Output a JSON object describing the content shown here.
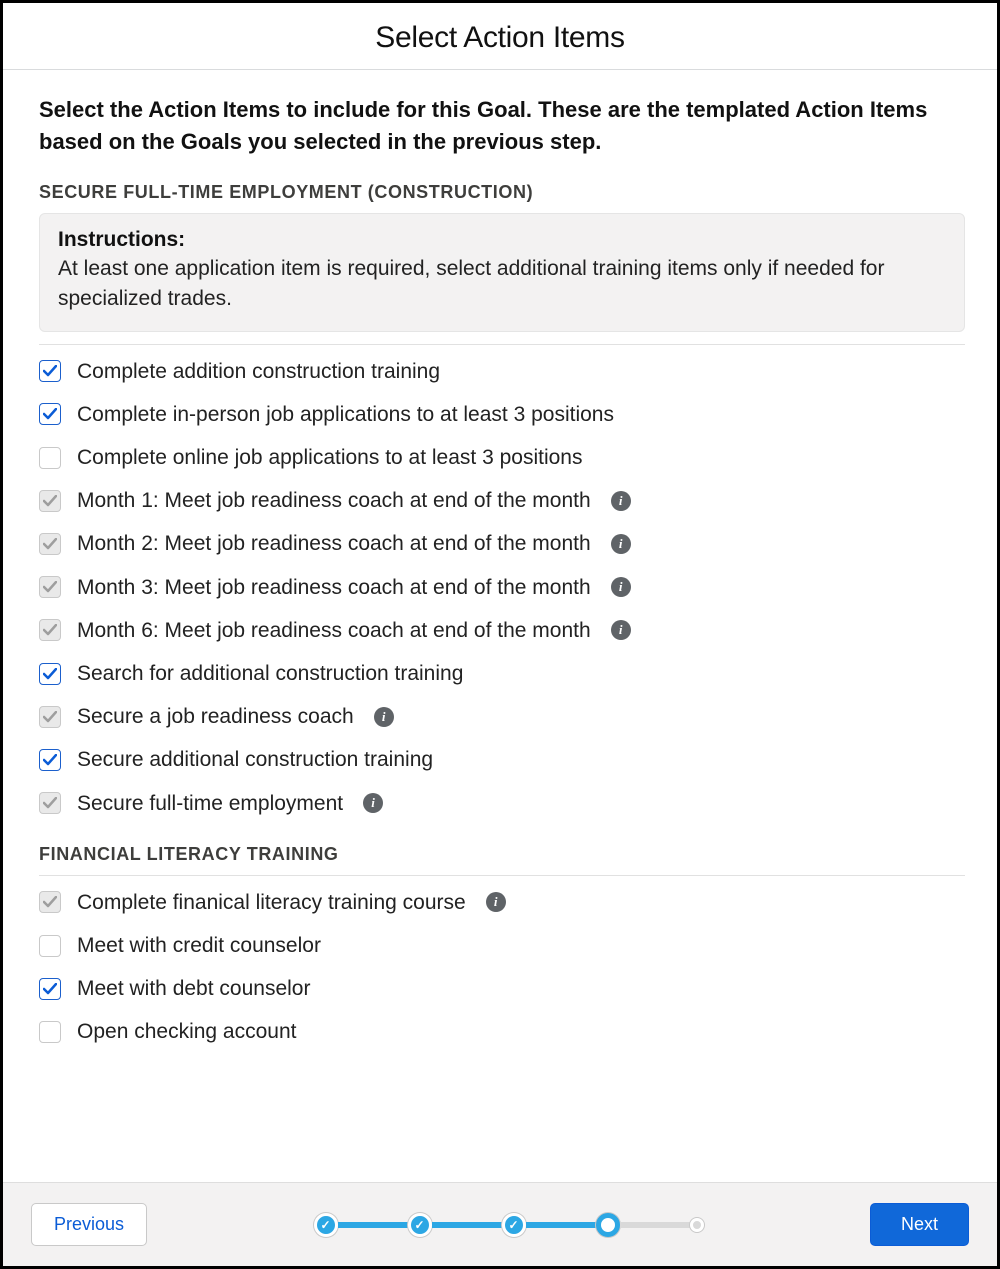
{
  "header": {
    "title": "Select Action Items"
  },
  "intro": "Select the Action Items to include for this Goal. These are the templated Action Items based on the Goals you selected in the previous step.",
  "sections": [
    {
      "title": "SECURE FULL-TIME EMPLOYMENT (CONSTRUCTION)",
      "instructions": {
        "label": "Instructions:",
        "text": "At least one application item is required, select additional training items only if needed for specialized trades."
      },
      "items": [
        {
          "label": "Complete addition construction training",
          "state": "checked",
          "info": false
        },
        {
          "label": "Complete in-person job applications to at least 3 positions",
          "state": "checked",
          "info": false
        },
        {
          "label": "Complete online job applications to at least 3 positions",
          "state": "unchecked",
          "info": false
        },
        {
          "label": "Month 1: Meet job readiness coach at end of the month",
          "state": "locked",
          "info": true
        },
        {
          "label": "Month 2: Meet job readiness coach at end of the month",
          "state": "locked",
          "info": true
        },
        {
          "label": "Month 3: Meet job readiness coach at end of the month",
          "state": "locked",
          "info": true
        },
        {
          "label": "Month 6: Meet job readiness coach at end of the month",
          "state": "locked",
          "info": true
        },
        {
          "label": "Search for additional construction training",
          "state": "checked",
          "info": false
        },
        {
          "label": "Secure a job readiness coach",
          "state": "locked",
          "info": true
        },
        {
          "label": "Secure additional construction training",
          "state": "checked",
          "info": false
        },
        {
          "label": "Secure full-time employment",
          "state": "locked",
          "info": true
        }
      ]
    },
    {
      "title": "FINANCIAL LITERACY TRAINING",
      "items": [
        {
          "label": "Complete finanical literacy training course",
          "state": "locked",
          "info": true
        },
        {
          "label": "Meet with credit counselor",
          "state": "unchecked",
          "info": false
        },
        {
          "label": "Meet with debt counselor",
          "state": "checked",
          "info": false
        },
        {
          "label": "Open checking account",
          "state": "unchecked",
          "info": false
        }
      ]
    }
  ],
  "footer": {
    "previous": "Previous",
    "next": "Next",
    "steps": [
      "done",
      "done",
      "done",
      "current",
      "future"
    ]
  }
}
